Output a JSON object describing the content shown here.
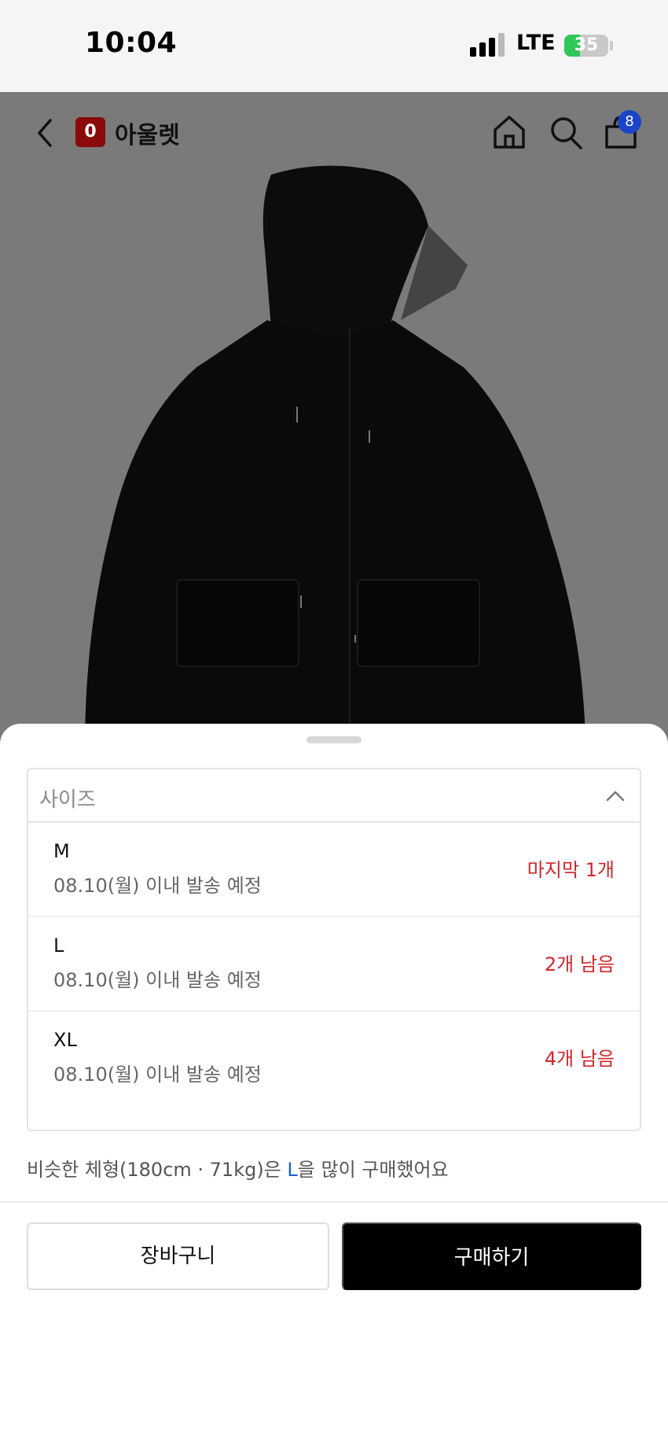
{
  "status_bar": {
    "time": "10:04",
    "network": "LTE",
    "battery_percent": "35",
    "battery_level": 0.35,
    "signal_bars_active": 3
  },
  "header": {
    "back_icon": "chevron-left-icon",
    "brand_logo_text": "0",
    "brand_name": "아울렛",
    "home_icon": "home-icon",
    "search_icon": "search-icon",
    "cart_icon": "shopping-bag-icon",
    "cart_count": "8",
    "colors": {
      "brand": "#8b0a0a",
      "badge": "#1a44c9"
    }
  },
  "product": {
    "image": "black hooded jacket"
  },
  "size_selector": {
    "label": "사이즈",
    "toggle_icon": "chevron-up-icon",
    "options": [
      {
        "size": "M",
        "shipping": "08.10(월) 이내 발송 예정",
        "stock": "마지막 1개"
      },
      {
        "size": "L",
        "shipping": "08.10(월) 이내 발송 예정",
        "stock": "2개 남음"
      },
      {
        "size": "XL",
        "shipping": "08.10(월) 이내 발송 예정",
        "stock": "4개 남음"
      }
    ],
    "stock_color": "#d3262b"
  },
  "recommendation": {
    "prefix": "비슷한 체형(180cm · 71kg)은 ",
    "highlight": "L",
    "suffix": "을 많이 구매했어요"
  },
  "actions": {
    "cart_label": "장바구니",
    "buy_label": "구매하기"
  }
}
